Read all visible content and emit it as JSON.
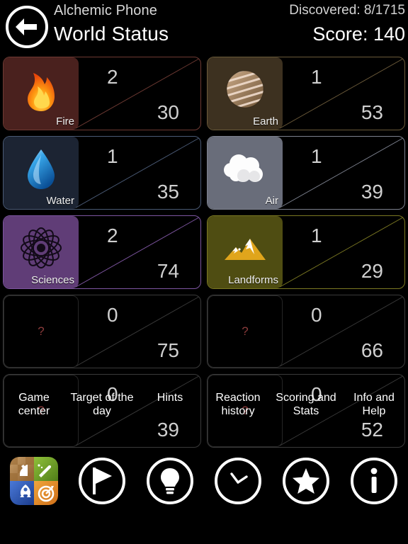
{
  "header": {
    "back_icon": "back-arrow-icon",
    "app_name": "Alchemic Phone",
    "page_title": "World Status",
    "discovered": "Discovered: 8/1715",
    "score": "Score: 140"
  },
  "groups": [
    {
      "name": "Fire",
      "icon": "fire-icon",
      "found": "2",
      "total": "30",
      "color": "#4a211e",
      "accent": "#6e3a33",
      "locked": false
    },
    {
      "name": "Earth",
      "icon": "planet-icon",
      "found": "1",
      "total": "53",
      "color": "#3d3120",
      "accent": "#6b5a3a",
      "locked": false
    },
    {
      "name": "Water",
      "icon": "water-drop-icon",
      "found": "1",
      "total": "35",
      "color": "#1c2433",
      "accent": "#4a5a75",
      "locked": false
    },
    {
      "name": "Air",
      "icon": "cloud-icon",
      "found": "1",
      "total": "39",
      "color": "#696d7a",
      "accent": "#7c818e",
      "locked": false
    },
    {
      "name": "Sciences",
      "icon": "atom-icon",
      "found": "2",
      "total": "74",
      "color": "#603d77",
      "accent": "#7d55a0",
      "locked": false
    },
    {
      "name": "Landforms",
      "icon": "mountain-icon",
      "found": "1",
      "total": "29",
      "color": "#4f4d12",
      "accent": "#7b7822",
      "locked": false
    },
    {
      "name": "?",
      "icon": "question-icon",
      "found": "0",
      "total": "75",
      "color": "#000000",
      "accent": "#3a3a3a",
      "locked": true
    },
    {
      "name": "?",
      "icon": "question-icon",
      "found": "0",
      "total": "66",
      "color": "#000000",
      "accent": "#3a3a3a",
      "locked": true
    },
    {
      "name": "?",
      "icon": "question-icon",
      "found": "0",
      "total": "39",
      "color": "#000000",
      "accent": "#3a3a3a",
      "locked": true
    },
    {
      "name": "?",
      "icon": "question-icon",
      "found": "0",
      "total": "52",
      "color": "#000000",
      "accent": "#3a3a3a",
      "locked": true
    }
  ],
  "toolbar": [
    {
      "label": "Game center",
      "icon": "game-center-icon"
    },
    {
      "label": "Target of the day",
      "icon": "play-flag-icon"
    },
    {
      "label": "Hints",
      "icon": "lightbulb-icon"
    },
    {
      "label": "Reaction history",
      "icon": "clock-icon"
    },
    {
      "label": "Scoring and Stats",
      "icon": "star-icon"
    },
    {
      "label": "Info and Help",
      "icon": "info-icon"
    }
  ]
}
